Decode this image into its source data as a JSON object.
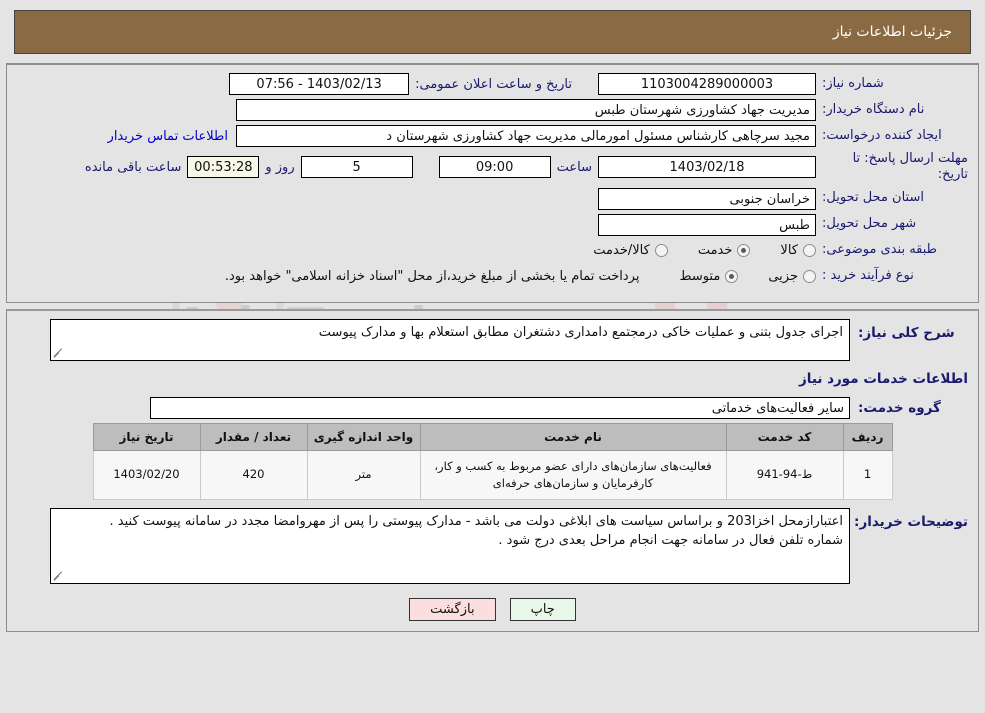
{
  "header": {
    "title": "جزئیات اطلاعات نیاز"
  },
  "form": {
    "need_number_label": "شماره نیاز:",
    "need_number_value": "1103004289000003",
    "public_announce_label": "تاریخ و ساعت اعلان عمومی:",
    "public_announce_value": "1403/02/13 - 07:56",
    "buyer_org_label": "نام دستگاه خریدار:",
    "buyer_org_value": "مدیریت جهاد کشاورزی شهرستان طبس",
    "creator_label": "ایجاد کننده درخواست:",
    "creator_value": "مجید سرچاهی کارشناس مسئول امورمالی مدیریت جهاد کشاورزی شهرستان د",
    "contact_link": "اطلاعات تماس خریدار",
    "deadline_label_line1": "مهلت ارسال پاسخ: تا",
    "deadline_label_line2": "تاریخ:",
    "deadline_date": "1403/02/18",
    "hour_label": "ساعت",
    "deadline_time": "09:00",
    "days_remaining": "5",
    "days_and_label": "روز و",
    "countdown": "00:53:28",
    "remaining_suffix": "ساعت باقی مانده",
    "province_label": "استان محل تحویل:",
    "province_value": "خراسان جنوبی",
    "city_label": "شهر محل تحویل:",
    "city_value": "طبس",
    "category_label": "طبقه بندی موضوعی:",
    "category_options": [
      {
        "label": "کالا",
        "selected": false
      },
      {
        "label": "خدمت",
        "selected": true
      },
      {
        "label": "کالا/خدمت",
        "selected": false
      }
    ],
    "process_label": "نوع فرآیند خرید :",
    "process_options": [
      {
        "label": "جزیی",
        "selected": false
      },
      {
        "label": "متوسط",
        "selected": true
      }
    ],
    "process_note": "پرداخت تمام یا بخشی از مبلغ خرید،از محل \"اسناد خزانه اسلامی\" خواهد بود."
  },
  "description": {
    "general_label": "شرح کلی نیاز:",
    "general_value": "اجرای جدول بتنی و عملیات خاکی درمجتمع دامداری دشتغران مطابق استعلام بها و مدارک پیوست",
    "services_title": "اطلاعات خدمات مورد نیاز",
    "service_group_label": "گروه خدمت:",
    "service_group_value": "سایر فعالیت‌های خدماتی"
  },
  "table": {
    "headers": [
      "ردیف",
      "کد خدمت",
      "نام خدمت",
      "واحد اندازه گیری",
      "تعداد / مقدار",
      "تاریخ نیاز"
    ],
    "rows": [
      {
        "index": "1",
        "code": "ط-94-941",
        "name": "فعالیت‌های سازمان‌های دارای عضو مربوط به کسب و کار، کارفرمایان و سازمان‌های حرفه‌ای",
        "unit": "متر",
        "quantity": "420",
        "need_date": "1403/02/20"
      }
    ]
  },
  "buyer_notes": {
    "label": "توضیحات خریدار:",
    "value": "اعتبارازمحل اخزا203 و براساس سیاست های ابلاغی دولت می باشد - مدارک پیوستی را پس از مهروامضا مجدد در سامانه پیوست کنید .\nشماره تلفن فعال در سامانه جهت انجام مراحل بعدی درج شود ."
  },
  "footer": {
    "print_label": "چاپ",
    "back_label": "بازگشت"
  },
  "watermark": {
    "text": "AriaTender.net"
  }
}
